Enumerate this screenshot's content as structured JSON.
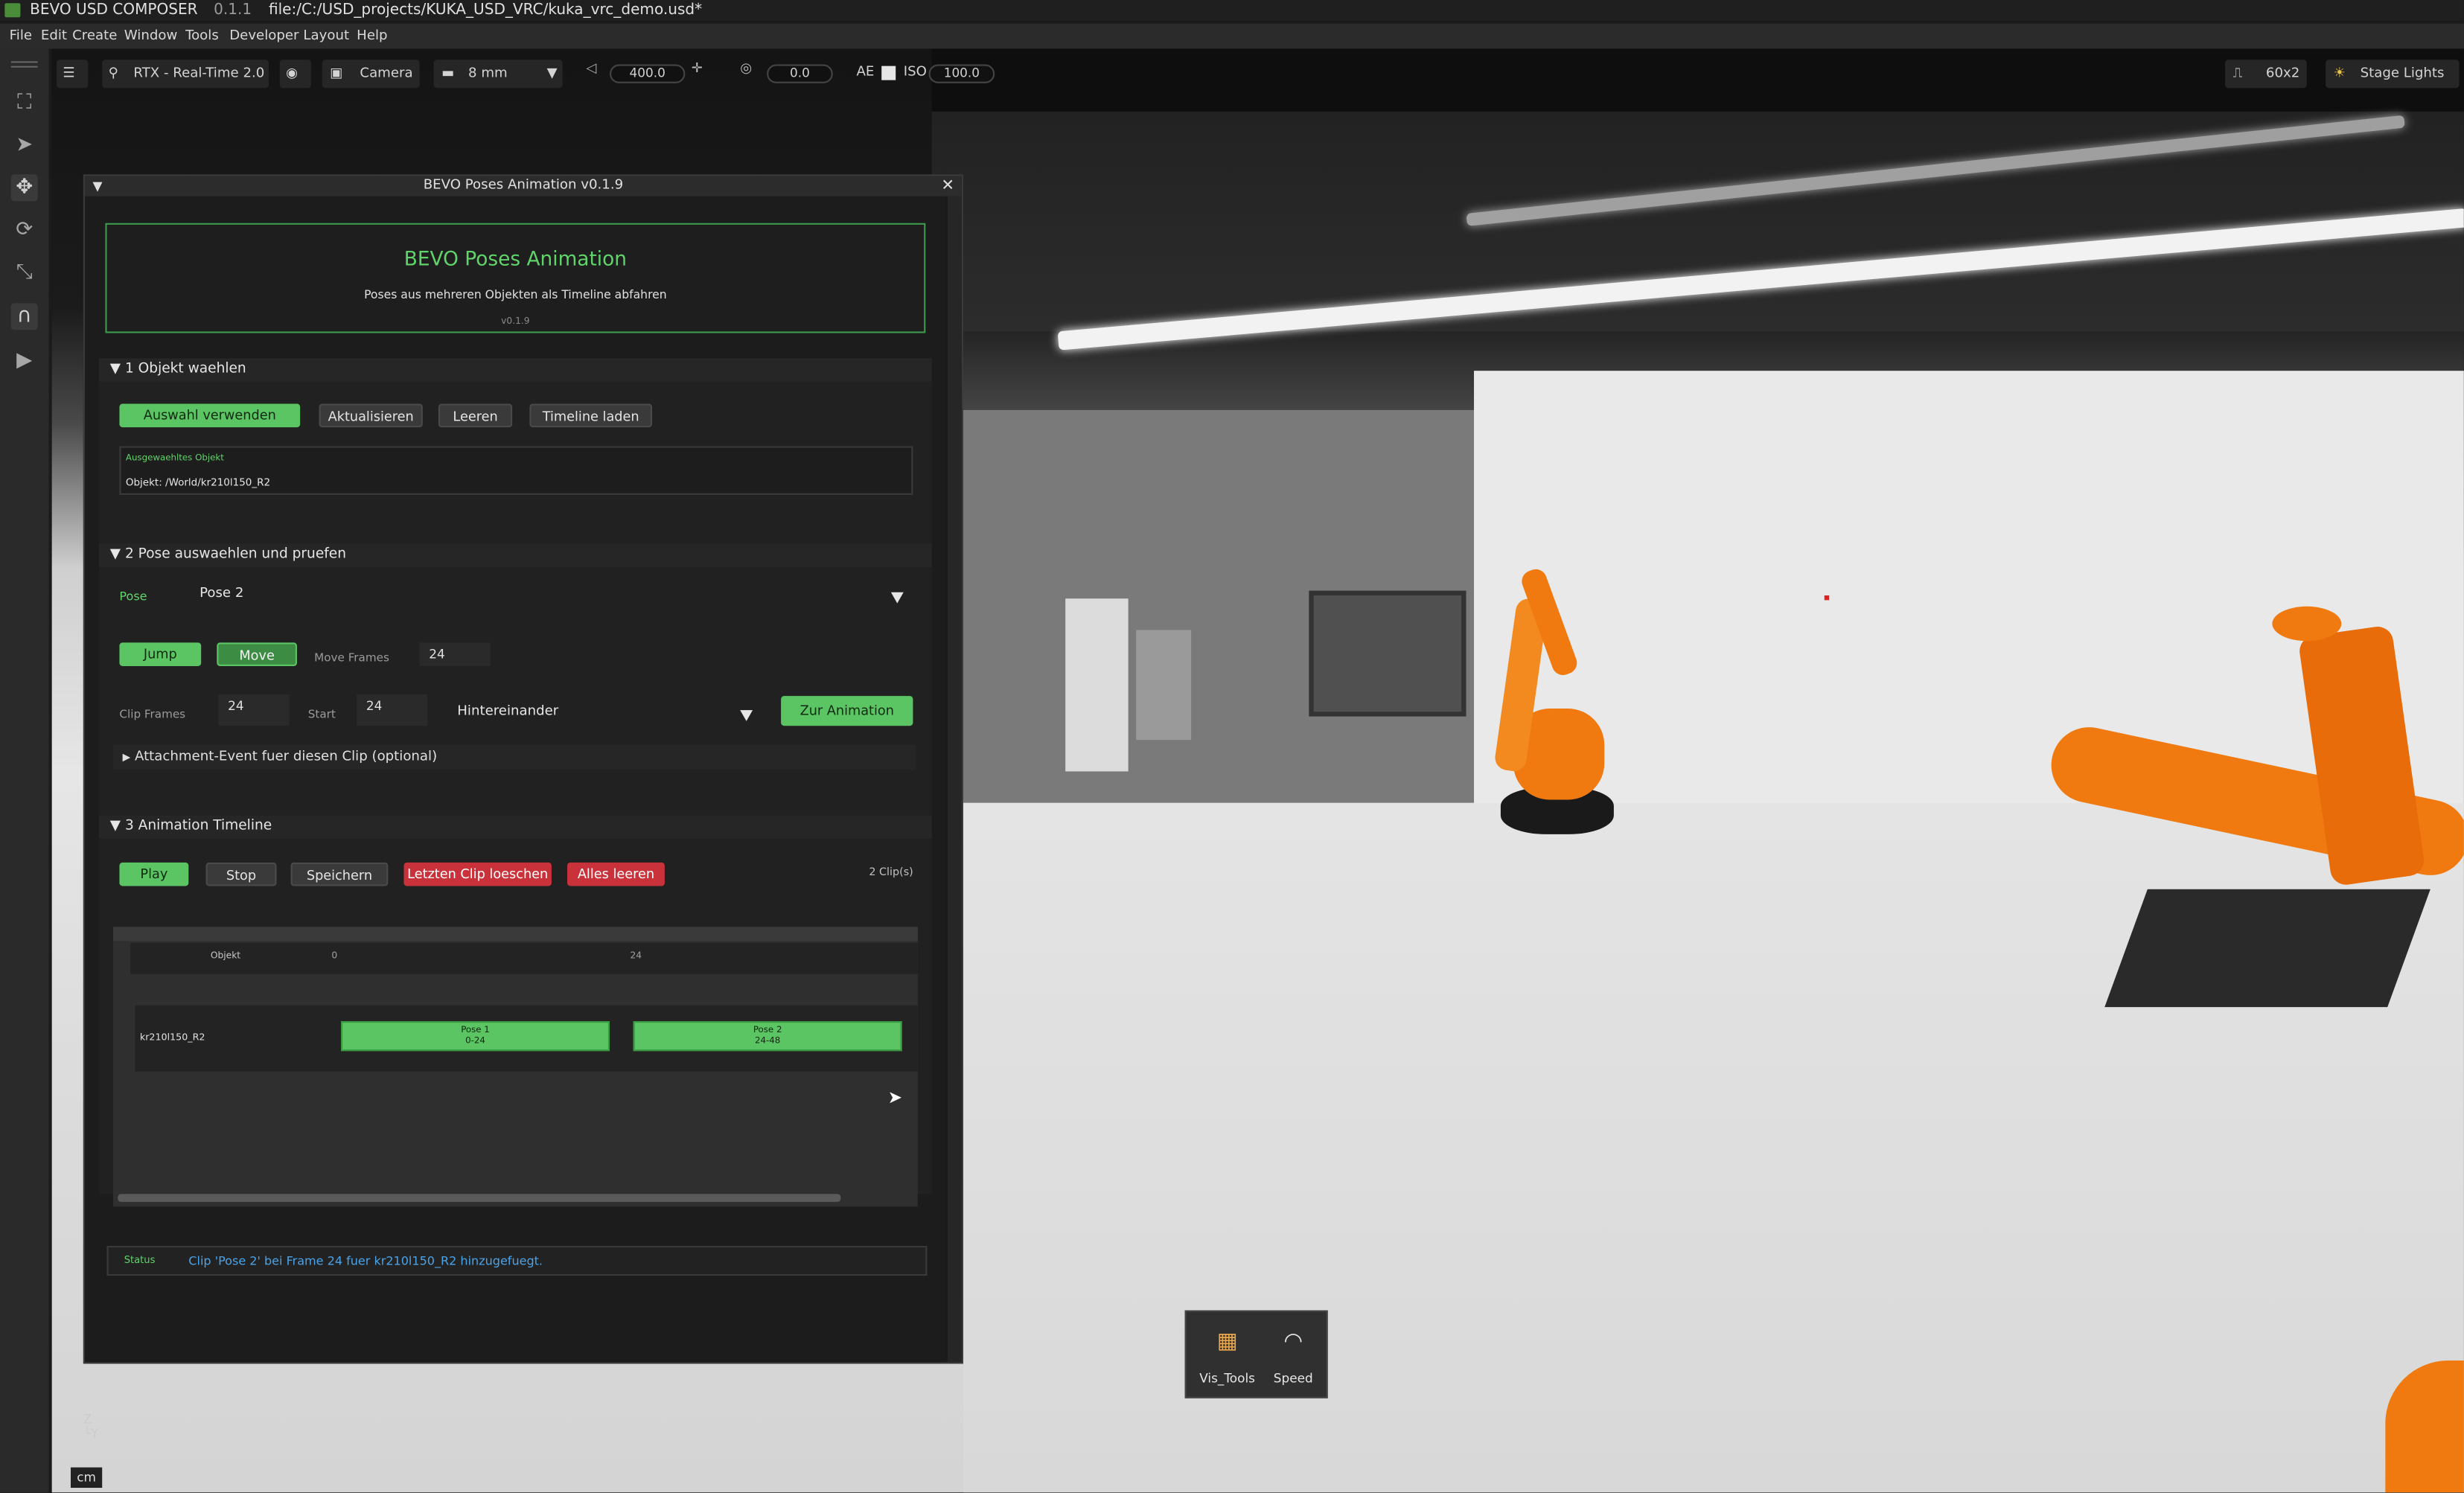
{
  "titlebar": {
    "app": "BEVO USD COMPOSER",
    "version": "0.1.1",
    "path": "file:/C:/USD_projects/KUKA_USD_VRC/kuka_vrc_demo.usd*"
  },
  "menubar": [
    "File",
    "Edit",
    "Create",
    "Window",
    "Tools",
    "Developer",
    "Layout",
    "Help"
  ],
  "viewport_toolbar": {
    "renderer": "RTX - Real-Time 2.0",
    "camera": "Camera",
    "lens": "8 mm",
    "clip_value": "400.0",
    "exposure_value": "0.0",
    "ae_label": "AE",
    "iso_label": "ISO",
    "iso_value": "100.0",
    "grid": "60x2",
    "lights": "Stage Lights"
  },
  "dialog": {
    "title": "BEVO Poses Animation v0.1.9",
    "header": {
      "title": "BEVO Poses Animation",
      "subtitle": "Poses aus mehreren Objekten als Timeline abfahren",
      "version": "v0.1.9"
    },
    "section1": {
      "title": "1  Objekt waehlen",
      "buttons": {
        "use_selection": "Auswahl verwenden",
        "refresh": "Aktualisieren",
        "clear": "Leeren",
        "load_timeline": "Timeline laden"
      },
      "selected_label": "Ausgewaehltes Objekt",
      "selected_value": "Objekt: /World/kr210l150_R2"
    },
    "section2": {
      "title": "2  Pose auswaehlen und pruefen",
      "pose_label": "Pose",
      "pose_value": "Pose 2",
      "jump": "Jump",
      "move": "Move",
      "move_frames_label": "Move Frames",
      "move_frames_value": "24",
      "clip_frames_label": "Clip Frames",
      "clip_frames_value": "24",
      "start_label": "Start",
      "start_value": "24",
      "mode_value": "Hintereinander",
      "to_animation": "Zur Animation",
      "attachment": "Attachment-Event fuer diesen Clip (optional)"
    },
    "section3": {
      "title": "3  Animation Timeline",
      "buttons": {
        "play": "Play",
        "stop": "Stop",
        "save": "Speichern",
        "delete_last": "Letzten Clip loeschen",
        "clear_all": "Alles leeren"
      },
      "clip_count": "2 Clip(s)",
      "header_object": "Objekt",
      "tick0": "0",
      "tick1": "24",
      "row_name": "kr210l150_R2",
      "clips": [
        {
          "name": "Pose 1",
          "range": "0-24"
        },
        {
          "name": "Pose 2",
          "range": "24-48"
        }
      ]
    },
    "status": {
      "label": "Status",
      "text": "Clip 'Pose 2' bei Frame 24 fuer kr210l150_R2 hinzugefuegt."
    }
  },
  "overlay": {
    "vis_tools": "Vis_Tools",
    "speed": "Speed"
  },
  "axis_unit": "cm",
  "colors": {
    "accent_green": "#5cc563",
    "danger_red": "#c9323a",
    "status_blue": "#4aa3e8",
    "robot_orange": "#f07a10"
  }
}
